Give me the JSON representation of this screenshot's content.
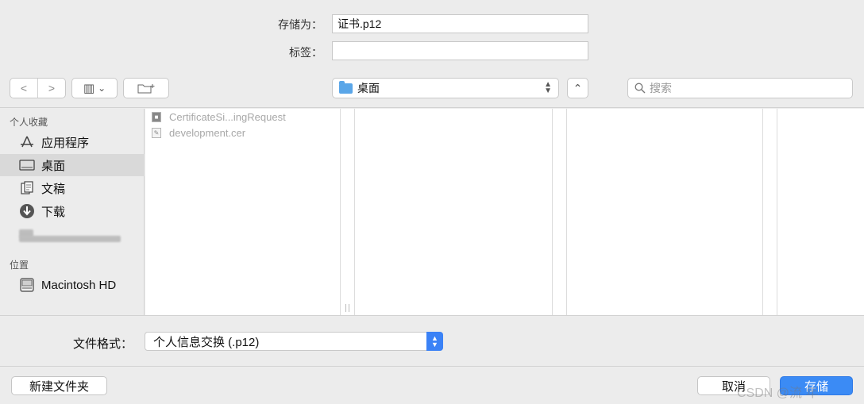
{
  "save_as": {
    "label": "存储为：",
    "value": "证书.p12"
  },
  "tags": {
    "label": "标签：",
    "value": ""
  },
  "toolbar": {
    "back": "<",
    "forward": ">",
    "view_icon": "▥",
    "view_chevron": "⌄",
    "location": "桌面",
    "expand": "⌃",
    "search_placeholder": "搜索"
  },
  "sidebar": {
    "favorites_header": "个人收藏",
    "favorites": [
      {
        "label": "应用程序",
        "icon": "apps-icon"
      },
      {
        "label": "桌面",
        "icon": "desktop-icon",
        "selected": true
      },
      {
        "label": "文稿",
        "icon": "documents-icon"
      },
      {
        "label": "下载",
        "icon": "downloads-icon"
      }
    ],
    "locations_header": "位置",
    "locations": [
      {
        "label": "Macintosh HD",
        "icon": "disk-icon"
      }
    ]
  },
  "files": [
    {
      "name": "CertificateSi...ingRequest",
      "icon": "certificate-request-icon"
    },
    {
      "name": "development.cer",
      "icon": "certificate-icon"
    }
  ],
  "format": {
    "label": "文件格式：",
    "value": "个人信息交换 (.p12)"
  },
  "buttons": {
    "new_folder": "新建文件夹",
    "cancel": "取消",
    "save": "存储"
  },
  "watermark": "CSDN @流    年"
}
